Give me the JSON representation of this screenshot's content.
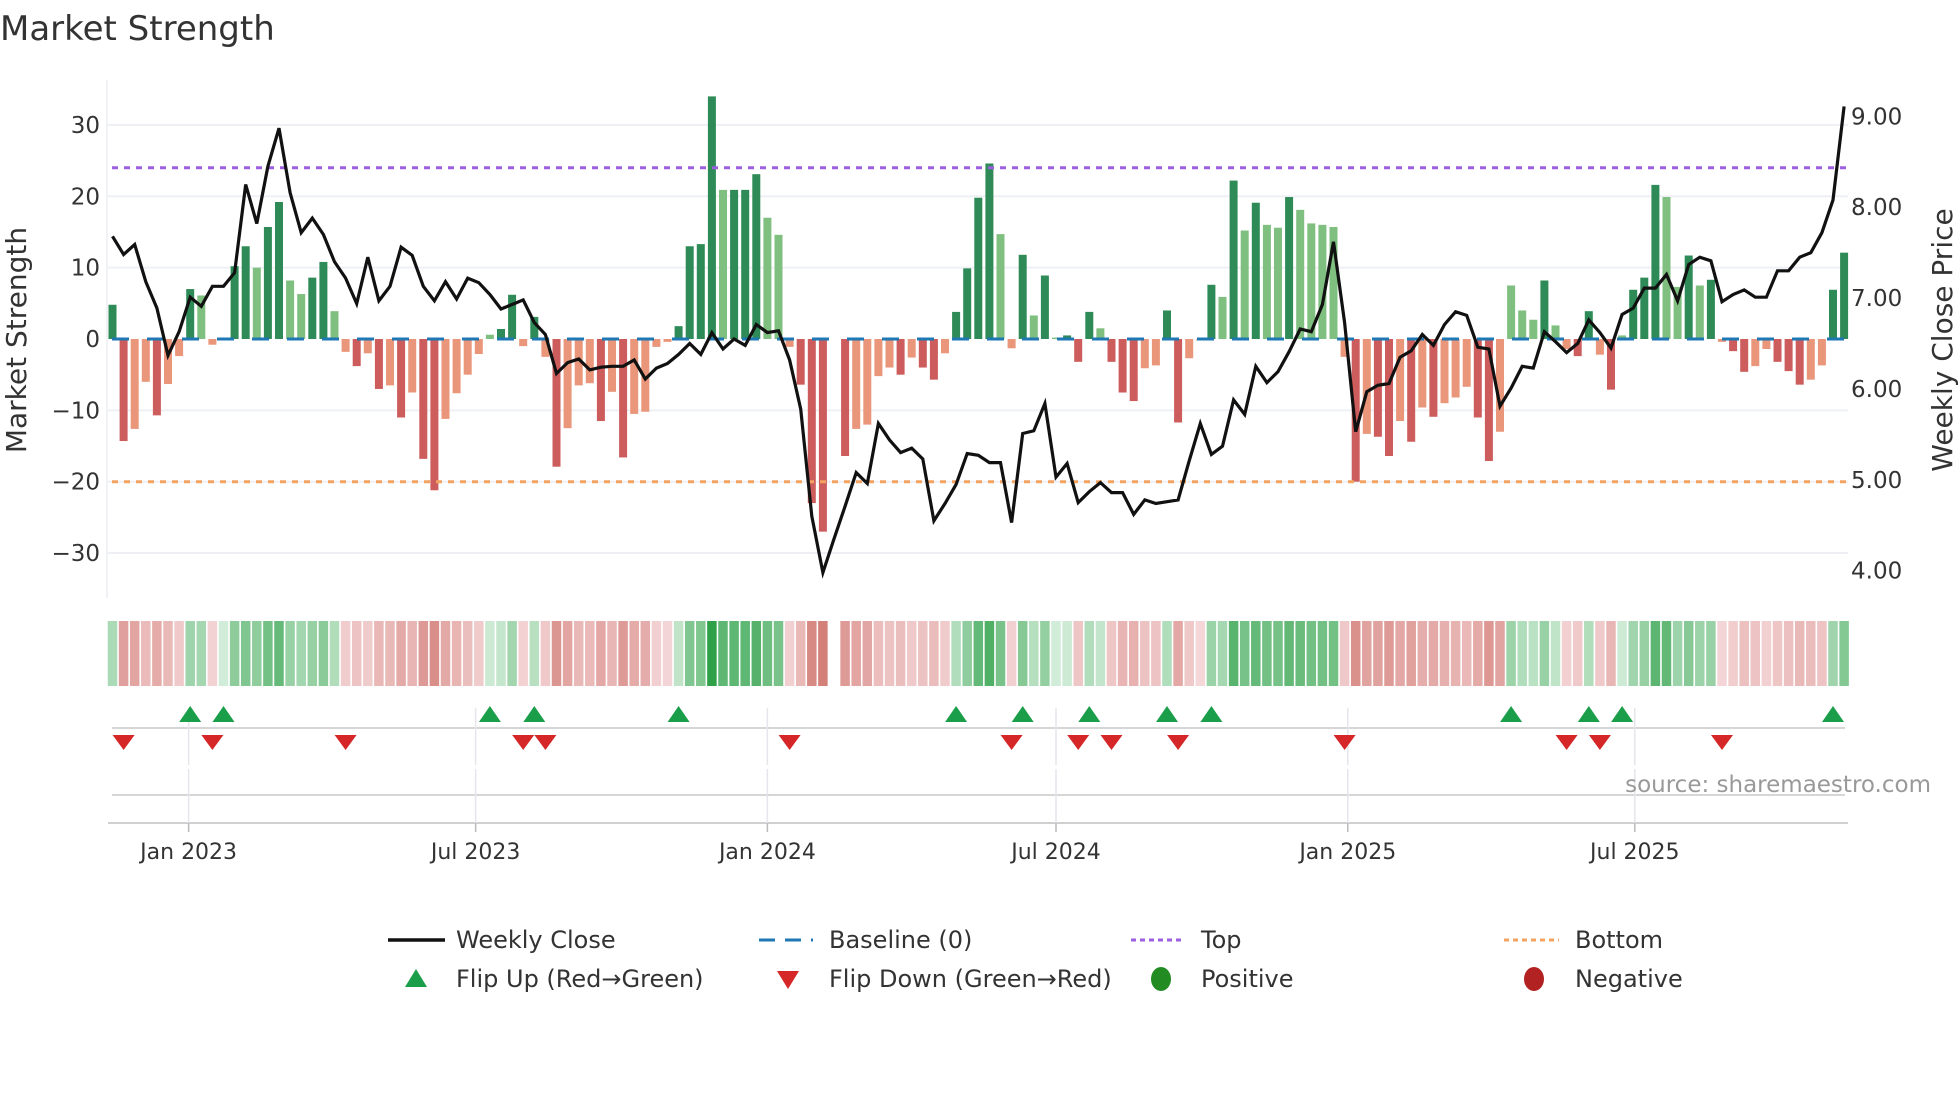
{
  "chart_data": {
    "type": "bar",
    "title": "Market Strength",
    "ylabel": "Market Strength",
    "y2label": "Weekly Close Price",
    "xlabel": "",
    "frequency": "weekly",
    "start_date": "2022-11-14",
    "ylim": [
      -36.3,
      36.3
    ],
    "y2lim": [
      3.7,
      9.4
    ],
    "yticks": [
      30,
      20,
      10,
      0,
      -10,
      -20,
      -30
    ],
    "ytick_labels": [
      "30",
      "20",
      "10",
      "0",
      "−10",
      "−20",
      "−30"
    ],
    "y2ticks": [
      9,
      8,
      7,
      6,
      5,
      4
    ],
    "y2tick_labels": [
      "9.00",
      "8.00",
      "7.00",
      "6.00",
      "5.00",
      "4.00"
    ],
    "xticks": [
      {
        "date": "2023-01-01",
        "label": "Jan 2023"
      },
      {
        "date": "2023-07-01",
        "label": "Jul 2023"
      },
      {
        "date": "2024-01-01",
        "label": "Jan 2024"
      },
      {
        "date": "2024-07-01",
        "label": "Jul 2024"
      },
      {
        "date": "2025-01-01",
        "label": "Jan 2025"
      },
      {
        "date": "2025-07-01",
        "label": "Jul 2025"
      }
    ],
    "grid": true,
    "reference_lines": {
      "baseline": 0,
      "top": 24,
      "bottom": -20
    },
    "strength": [
      4.8,
      -14.3,
      -12.6,
      -6,
      -10.7,
      -6.3,
      -2.4,
      7,
      6.1,
      -0.8,
      0.2,
      10.2,
      13,
      10,
      15.7,
      19.2,
      8.2,
      6.3,
      8.6,
      10.8,
      3.9,
      -1.8,
      -3.8,
      -2,
      -7,
      -6.5,
      -11,
      -7.5,
      -16.8,
      -21.2,
      -11.2,
      -7.6,
      -5,
      -2.1,
      0.6,
      1.4,
      6.2,
      -1,
      3.1,
      -2.5,
      -17.9,
      -12.5,
      -6.5,
      -6.2,
      -11.5,
      -7.4,
      -16.6,
      -10.5,
      -10.2,
      -1.1,
      -0.4,
      1.8,
      13,
      13.3,
      34,
      20.9,
      20.9,
      20.9,
      23.1,
      17,
      14.6,
      -1.1,
      -6.4,
      -23,
      -27,
      null,
      -16.4,
      -12.6,
      -12,
      -5.2,
      -4,
      -5,
      -2.6,
      -4,
      -5.7,
      -2,
      3.8,
      9.9,
      19.8,
      24.6,
      14.7,
      -1.3,
      11.8,
      3.3,
      8.9,
      0.2,
      0.5,
      -3.2,
      3.8,
      1.5,
      -3.2,
      -7.5,
      -8.7,
      -4.1,
      -3.7,
      4,
      -11.7,
      -2.7,
      -0.2,
      7.6,
      5.9,
      22.2,
      15.2,
      19.1,
      16,
      15.6,
      19.9,
      18.1,
      16.2,
      16,
      15.7,
      -2.5,
      -20,
      -13.3,
      -13.7,
      -16.4,
      -11.5,
      -14.4,
      -9.6,
      -10.9,
      -9,
      -8.2,
      -6.7,
      -11,
      -17.1,
      -13,
      7.5,
      4,
      2.7,
      8.2,
      1.9,
      -1.4,
      -2.4,
      3.9,
      -2.2,
      -7.1,
      0.5,
      6.9,
      8.6,
      21.6,
      19.9,
      7.3,
      11.7,
      7.5,
      8.3,
      -0.4,
      -1.7,
      -4.6,
      -3.8,
      -1.4,
      -3.2,
      -4.5,
      -6.4,
      -5.7,
      -3.7,
      6.9,
      12.1
    ],
    "weekly_close": [
      7.68,
      7.48,
      7.59,
      7.18,
      6.89,
      6.37,
      6.63,
      7.01,
      6.91,
      7.13,
      7.13,
      7.28,
      8.25,
      7.82,
      8.45,
      8.87,
      8.16,
      7.72,
      7.88,
      7.7,
      7.4,
      7.22,
      6.94,
      7.45,
      6.97,
      7.13,
      7.56,
      7.47,
      7.13,
      6.97,
      7.18,
      6.99,
      7.22,
      7.17,
      7.04,
      6.88,
      6.93,
      6.98,
      6.73,
      6.6,
      6.17,
      6.29,
      6.33,
      6.21,
      6.24,
      6.25,
      6.25,
      6.32,
      6.11,
      6.23,
      6.28,
      6.38,
      6.5,
      6.38,
      6.62,
      6.44,
      6.55,
      6.48,
      6.71,
      6.62,
      6.64,
      6.32,
      5.78,
      4.6,
      3.98,
      4.35,
      4.71,
      5.08,
      4.96,
      5.62,
      5.44,
      5.3,
      5.35,
      5.23,
      4.55,
      4.74,
      4.95,
      5.29,
      5.27,
      5.19,
      5.19,
      4.53,
      5.51,
      5.54,
      5.84,
      5.03,
      5.18,
      4.75,
      4.87,
      4.97,
      4.86,
      4.86,
      4.62,
      4.78,
      4.74,
      4.76,
      4.78,
      5.21,
      5.62,
      5.28,
      5.37,
      5.88,
      5.72,
      6.25,
      6.07,
      6.19,
      6.41,
      6.66,
      6.63,
      6.93,
      7.62,
      6.73,
      5.53,
      5.97,
      6.04,
      6.06,
      6.35,
      6.42,
      6.6,
      6.48,
      6.71,
      6.85,
      6.81,
      6.46,
      6.44,
      5.81,
      6.01,
      6.25,
      6.23,
      6.63,
      6.52,
      6.4,
      6.5,
      6.76,
      6.62,
      6.45,
      6.82,
      6.89,
      7.11,
      7.11,
      7.26,
      6.97,
      7.37,
      7.45,
      7.41,
      6.96,
      7.04,
      7.09,
      7.01,
      7.01,
      7.3,
      7.3,
      7.45,
      7.5,
      7.72,
      8.08,
      9.11
    ],
    "flip_up_weeks": [
      7,
      10,
      34,
      38,
      51,
      76,
      82,
      88,
      95,
      99,
      126,
      133,
      136,
      155
    ],
    "flip_down_weeks": [
      1,
      9,
      21,
      37,
      39,
      61,
      81,
      87,
      90,
      96,
      111,
      131,
      134,
      145
    ],
    "legend": {
      "placement": "bottom",
      "items": [
        {
          "label": "Weekly Close",
          "symbol": "line"
        },
        {
          "label": "Baseline (0)",
          "symbol": "dash"
        },
        {
          "label": "Top",
          "symbol": "dot"
        },
        {
          "label": "Bottom",
          "symbol": "dot"
        },
        {
          "label": "Flip Up (Red→Green)",
          "symbol": "triangle-up"
        },
        {
          "label": "Flip Down (Green→Red)",
          "symbol": "triangle-down"
        },
        {
          "label": "Positive",
          "symbol": "circle"
        },
        {
          "label": "Negative",
          "symbol": "circle"
        }
      ]
    },
    "annotation": "source: sharemaestro.com"
  },
  "colors": {
    "pos_strong": "#2e8b57",
    "pos_weak": "#7fbf7f",
    "neg_strong": "#cd5c5c",
    "neg_weak": "#e9967a",
    "price": "#111111",
    "baseline": "#1f77b4",
    "top": "#9b5fe0",
    "bottom": "#f4a460",
    "flip_up": "#1a9e4a",
    "flip_down": "#d62728",
    "positive": "#228b22",
    "negative": "#b22222"
  }
}
